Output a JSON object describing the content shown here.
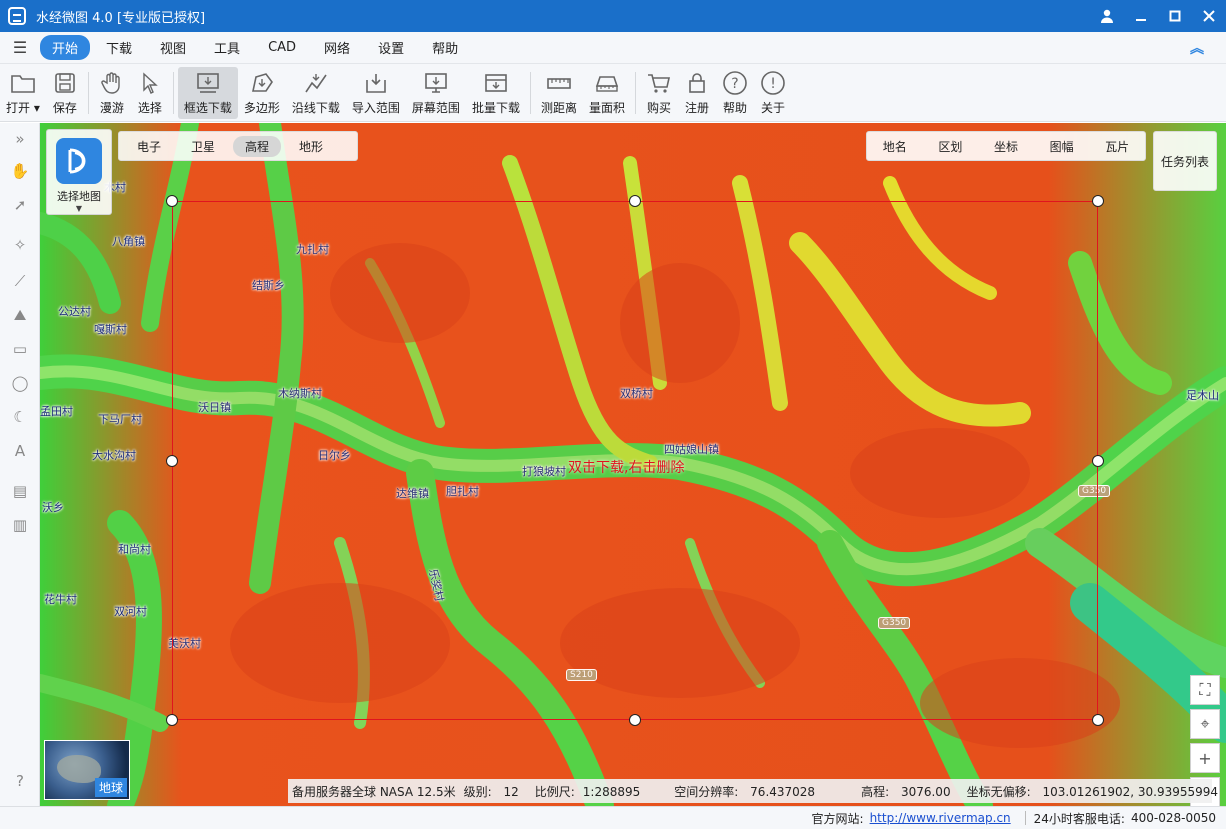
{
  "app": {
    "title": "水经微图 4.0 [专业版已授权]"
  },
  "menu": {
    "items": [
      {
        "label": "开始",
        "active": true
      },
      {
        "label": "下载"
      },
      {
        "label": "视图"
      },
      {
        "label": "工具"
      },
      {
        "label": "CAD"
      },
      {
        "label": "网络"
      },
      {
        "label": "设置"
      },
      {
        "label": "帮助"
      }
    ]
  },
  "toolbar": {
    "open": "打开",
    "save": "保存",
    "pan": "漫游",
    "select": "选择",
    "box_download": "框选下载",
    "polygon": "多边形",
    "line_download": "沿线下载",
    "import_range": "导入范围",
    "screen_range": "屏幕范围",
    "batch_download": "批量下载",
    "measure_distance": "测距离",
    "measure_area": "量面积",
    "buy": "购买",
    "register": "注册",
    "help": "帮助",
    "about": "关于"
  },
  "map": {
    "choose_map_label": "选择地图",
    "layers": [
      {
        "label": "电子"
      },
      {
        "label": "卫星"
      },
      {
        "label": "高程",
        "active": true
      },
      {
        "label": "地形"
      }
    ],
    "overlay_tabs": [
      "地名",
      "区划",
      "坐标",
      "图幅",
      "瓦片"
    ],
    "task_list": "任务列表",
    "selection_hint": "双击下载,右击删除",
    "globe_label": "地球",
    "places": [
      "八角镇",
      "九扎村",
      "结斯乡",
      "公达村",
      "嘎斯村",
      "沃日镇",
      "木纳斯村",
      "双桥村",
      "四姑娘山镇",
      "日尔乡",
      "达维镇",
      "胆扎村",
      "打狼坡村",
      "下马厂村",
      "大水沟村",
      "和尚村",
      "花牛村",
      "双河村",
      "美沃村",
      "足木山",
      "沃乡",
      "孟田村",
      "木村",
      "乐奖村"
    ],
    "roads": [
      "G350",
      "G350",
      "S210"
    ],
    "status": {
      "server": "备用服务器全球 NASA 12.5米",
      "level_label": "级别:",
      "level": "12",
      "scale_label": "比例尺:",
      "scale": "1:288895",
      "resolution_label": "空间分辨率:",
      "resolution": "76.437028",
      "elevation_label": "高程:",
      "elevation": "3076.00",
      "coord_label": "坐标无偏移:",
      "coord": "103.01261902, 30.93955994"
    }
  },
  "bottom": {
    "website_label": "官方网站:",
    "website": "http://www.rivermap.cn",
    "hotline_label": "24小时客服电话:",
    "hotline": "400-028-0050"
  },
  "colors": {
    "accent": "#2f86e0",
    "titlebar": "#1a6fc9",
    "selection": "#e0141e"
  }
}
